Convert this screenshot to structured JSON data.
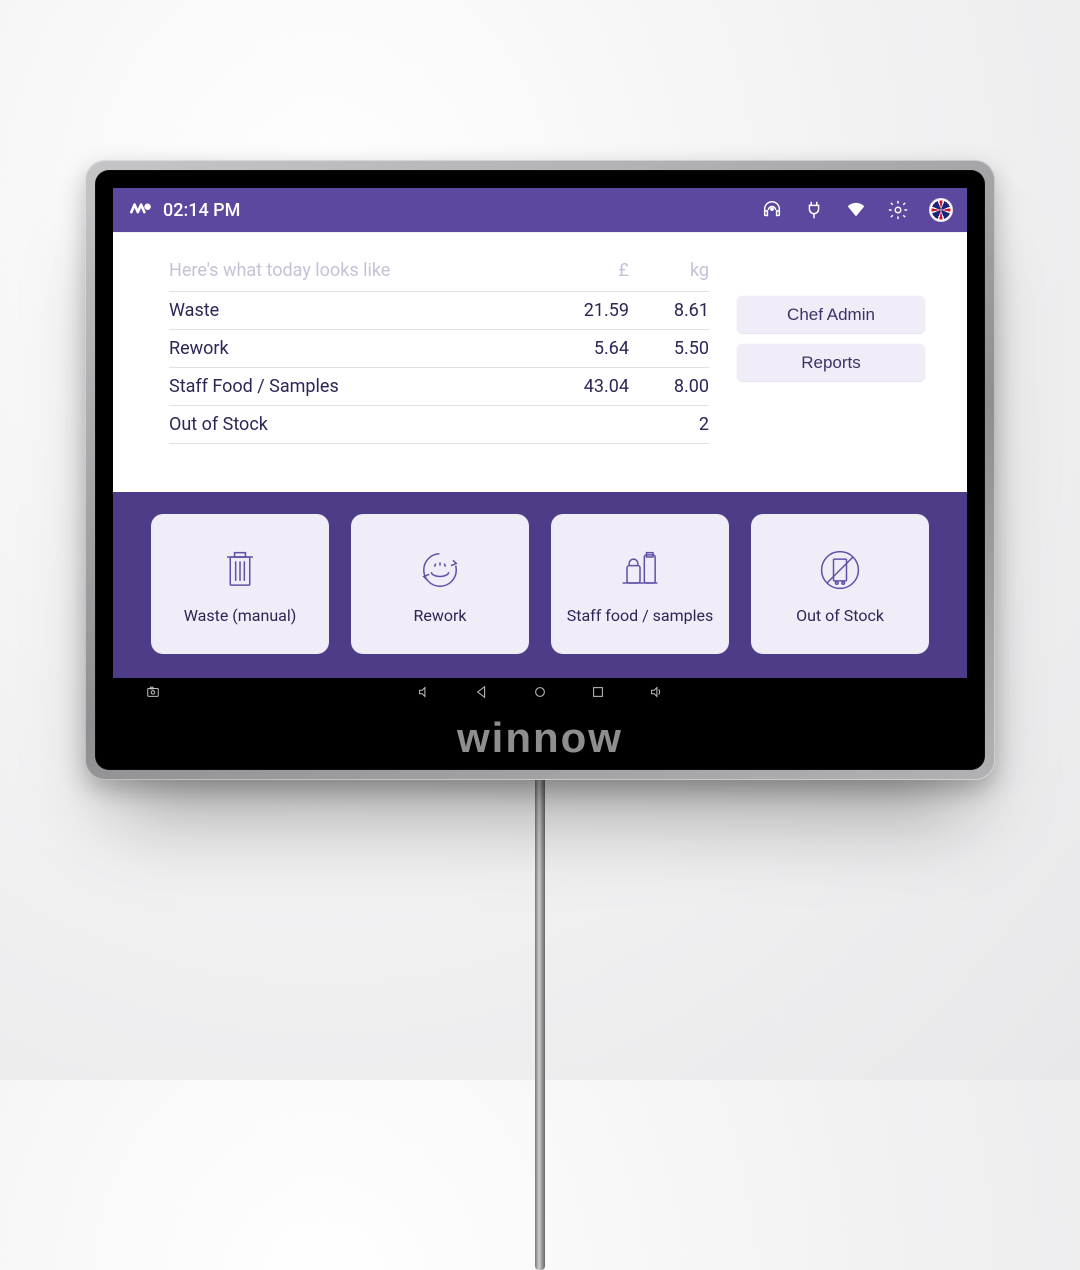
{
  "statusbar": {
    "time": "02:14 PM"
  },
  "summary": {
    "heading": "Here's what today looks like",
    "columns": {
      "cost": "£",
      "weight": "kg"
    },
    "rows": [
      {
        "label": "Waste",
        "cost": "21.59",
        "weight": "8.61"
      },
      {
        "label": "Rework",
        "cost": "5.64",
        "weight": "5.50"
      },
      {
        "label": "Staff Food / Samples",
        "cost": "43.04",
        "weight": "8.00"
      },
      {
        "label": "Out of Stock",
        "cost": "",
        "weight": "2"
      }
    ]
  },
  "side_buttons": [
    {
      "label": "Chef Admin"
    },
    {
      "label": "Reports"
    }
  ],
  "tiles": [
    {
      "label": "Waste (manual)"
    },
    {
      "label": "Rework"
    },
    {
      "label": "Staff food / samples"
    },
    {
      "label": "Out of Stock"
    }
  ],
  "brand": "winnow"
}
